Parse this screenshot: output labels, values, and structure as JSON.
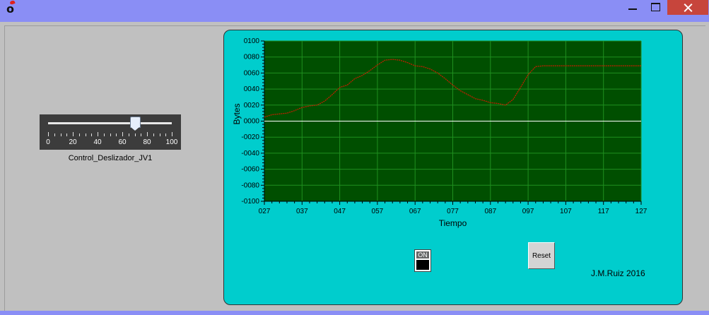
{
  "window": {
    "title": ""
  },
  "slider": {
    "caption": "Control_Deslizador_JV1",
    "min": 0,
    "max": 100,
    "value": 70,
    "ticks": [
      "0",
      "20",
      "40",
      "60",
      "80",
      "100"
    ]
  },
  "buttons": {
    "on_label": "ON",
    "reset_label": "Reset"
  },
  "credit": "J.M.Ruiz 2016",
  "colors": {
    "panel": "#00cdcd",
    "plot_bg": "#004f00",
    "grid": "#1f8f1f",
    "trace": "#c02000",
    "zero_line": "#ffffff"
  },
  "chart_data": {
    "type": "line",
    "title": "",
    "xlabel": "Tiempo",
    "ylabel": "Bytes",
    "xlim": [
      27,
      127
    ],
    "ylim": [
      -100,
      100
    ],
    "x_ticks": [
      "027",
      "037",
      "047",
      "057",
      "067",
      "077",
      "087",
      "097",
      "107",
      "117",
      "127"
    ],
    "y_ticks": [
      "0100",
      "0080",
      "0060",
      "0040",
      "0020",
      "0000",
      "-0020",
      "-0040",
      "-0060",
      "-0080",
      "-0100"
    ],
    "grid": true,
    "reference_line": 0,
    "series": [
      {
        "x": [
          27,
          29,
          31,
          33,
          35,
          37,
          39,
          41,
          43,
          45,
          47,
          49,
          51,
          53,
          55,
          57,
          59,
          61,
          63,
          65,
          67,
          69,
          71,
          73,
          75,
          77,
          79,
          81,
          83,
          85,
          87,
          89,
          91,
          93,
          95,
          97,
          99,
          101,
          103,
          105,
          107,
          109,
          111,
          113,
          115,
          117,
          119,
          121,
          123,
          125,
          127
        ],
        "y": [
          5,
          8,
          9,
          10,
          13,
          17,
          19,
          20,
          25,
          33,
          42,
          45,
          53,
          57,
          63,
          70,
          76,
          77,
          76,
          73,
          69,
          68,
          65,
          60,
          53,
          45,
          38,
          33,
          28,
          26,
          23,
          22,
          20,
          27,
          42,
          58,
          68,
          69,
          69,
          69,
          69,
          69,
          69,
          69,
          69,
          69,
          69,
          69,
          69,
          69,
          69
        ]
      }
    ]
  }
}
